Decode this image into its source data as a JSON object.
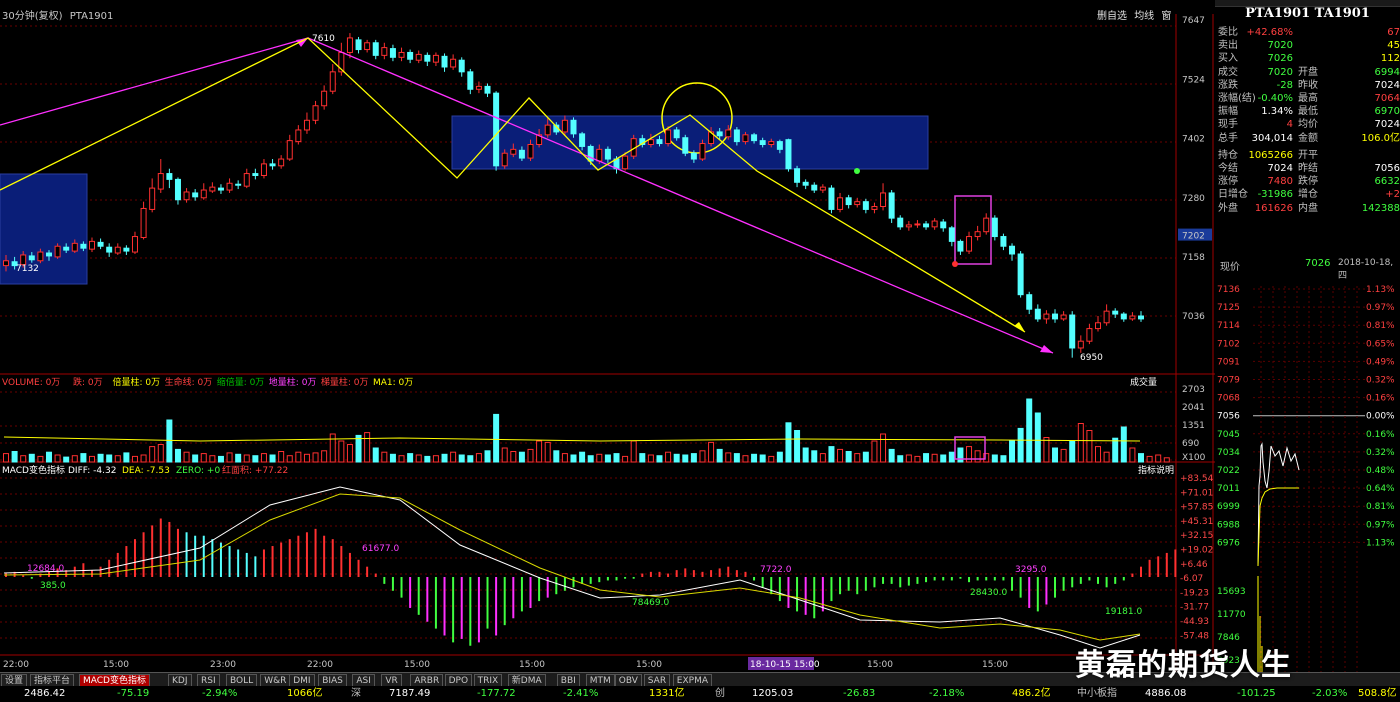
{
  "header": {
    "period_label": "30分钟(复权)",
    "symbol": "PTA1901",
    "right_tools": [
      "删自选",
      "均线",
      "窗"
    ]
  },
  "price_axis": [
    "7647",
    "7524",
    "7402",
    "7280",
    "7202",
    "7158",
    "7036"
  ],
  "price_annotations": {
    "high": "7610",
    "low_left": "7132",
    "low_right": "6950"
  },
  "volume_panel": {
    "title_items": [
      {
        "label": "VOLUME: 0万",
        "color": "#ff4040"
      },
      {
        "label": "跌: 0万",
        "color": "#ff4040"
      },
      {
        "label": "倍量柱: 0万",
        "color": "#ffff00"
      },
      {
        "label": "生命线: 0万",
        "color": "#ff4040"
      },
      {
        "label": "缩倍量: 0万",
        "color": "#00c000"
      },
      {
        "label": "地量柱: 0万",
        "color": "#ff40ff"
      },
      {
        "label": "梯量柱: 0万",
        "color": "#ff4040"
      },
      {
        "label": "MA1: 0万",
        "color": "#ffff00"
      }
    ],
    "right_label": "成交量",
    "axis": [
      "2703",
      "2041",
      "1351",
      "690",
      "X100"
    ]
  },
  "macd_panel": {
    "title": "MACD变色指标",
    "diff": "DIFF: -4.32",
    "dea": "DEA: -7.53",
    "zero": "ZERO: +0",
    "red_area": "红面积: +77.22",
    "right_label": "指标说明",
    "axis": [
      "+83.54",
      "+71.01",
      "+57.85",
      "+45.31",
      "+32.15",
      "+19.02",
      "+6.46",
      "-6.07",
      "-19.23",
      "-31.77",
      "-44.93",
      "-57.48"
    ],
    "area_labels": [
      {
        "text": "12684.0",
        "color": "#ff40ff"
      },
      {
        "text": "385.0",
        "color": "#40ff40"
      },
      {
        "text": "61677.0",
        "color": "#ff40ff"
      },
      {
        "text": "78469.0",
        "color": "#40ff40"
      },
      {
        "text": "7722.0",
        "color": "#ff40ff"
      },
      {
        "text": "28430.0",
        "color": "#40ff40"
      },
      {
        "text": "3295.0",
        "color": "#ff40ff"
      },
      {
        "text": "19181.0",
        "color": "#40ff40"
      }
    ]
  },
  "time_axis": [
    "22:00",
    "15:00",
    "23:00",
    "22:00",
    "15:00",
    "15:00",
    "15:00",
    "18-10-15 15:00",
    "15:00",
    "15:00"
  ],
  "tabs": [
    "设置",
    "指标平台",
    "MACD变色指标",
    "KDJ",
    "RSI",
    "BOLL",
    "W&R",
    "DMI",
    "BIAS",
    "ASI",
    "VR",
    "ARBR",
    "DPO",
    "TRIX",
    "新DMA",
    "BBI",
    "MTM",
    "OBV",
    "SAR",
    "EXPMA"
  ],
  "active_tab": "MACD变色指标",
  "status_bar": [
    {
      "text": "2486.42",
      "color": "#ffffff"
    },
    {
      "text": "-75.19",
      "color": "#40ff40"
    },
    {
      "text": "-2.94%",
      "color": "#40ff40"
    },
    {
      "text": "1066亿",
      "color": "#ffff00"
    },
    {
      "text": "深",
      "color": "#c0c0c0"
    },
    {
      "text": "7187.49",
      "color": "#ffffff"
    },
    {
      "text": "-177.72",
      "color": "#40ff40"
    },
    {
      "text": "-2.41%",
      "color": "#40ff40"
    },
    {
      "text": "1331亿",
      "color": "#ffff00"
    },
    {
      "text": "创",
      "color": "#c0c0c0"
    },
    {
      "text": "1205.03",
      "color": "#ffffff"
    },
    {
      "text": "-26.83",
      "color": "#40ff40"
    },
    {
      "text": "-2.18%",
      "color": "#40ff40"
    },
    {
      "text": "486.2亿",
      "color": "#ffff00"
    },
    {
      "text": "中小板指",
      "color": "#c0c0c0"
    },
    {
      "text": "4886.08",
      "color": "#ffffff"
    },
    {
      "text": "-101.25",
      "color": "#40ff40"
    },
    {
      "text": "-2.03%",
      "color": "#40ff40"
    },
    {
      "text": "508.8亿",
      "color": "#ffff00"
    }
  ],
  "quote": {
    "title": "PTA1901 TA1901",
    "rows": [
      {
        "l1": "委比",
        "v1": "+42.68%",
        "c1": "#ff4040",
        "l2": "",
        "v2": "67",
        "c2": "#ff4040"
      },
      {
        "l1": "卖出",
        "v1": "7020",
        "c1": "#40ff40",
        "l2": "",
        "v2": "45",
        "c2": "#ffff00"
      },
      {
        "l1": "买入",
        "v1": "7026",
        "c1": "#40ff40",
        "l2": "",
        "v2": "112",
        "c2": "#ffff00"
      },
      {
        "l1": "成交",
        "v1": "7020",
        "c1": "#40ff40",
        "l2": "开盘",
        "v2": "6994",
        "c2": "#40ff40"
      },
      {
        "l1": "涨跌",
        "v1": "-28",
        "c1": "#40ff40",
        "l2": "昨收",
        "v2": "7024",
        "c2": "#ffffff"
      },
      {
        "l1": "涨幅(结)",
        "v1": "-0.40%",
        "c1": "#40ff40",
        "l2": "最高",
        "v2": "7064",
        "c2": "#ff4040"
      },
      {
        "l1": "振幅",
        "v1": "1.34%",
        "c1": "#ffffff",
        "l2": "最低",
        "v2": "6970",
        "c2": "#40ff40"
      },
      {
        "l1": "现手",
        "v1": "4",
        "c1": "#ff4040",
        "l2": "均价",
        "v2": "7024",
        "c2": "#ffffff"
      },
      {
        "l1": "总手",
        "v1": "304,014",
        "c1": "#ffffff",
        "l2": "金额",
        "v2": "106.0亿",
        "c2": "#ffff00"
      },
      {
        "l1": "持仓",
        "v1": "1065266",
        "c1": "#ffff00",
        "l2": "开平",
        "v2": "",
        "c2": "#ffffff"
      },
      {
        "l1": "今结",
        "v1": "7024",
        "c1": "#ffffff",
        "l2": "昨结",
        "v2": "7056",
        "c2": "#ffffff"
      },
      {
        "l1": "涨停",
        "v1": "7480",
        "c1": "#ff4040",
        "l2": "跌停",
        "v2": "6632",
        "c2": "#40ff40"
      },
      {
        "l1": "日增仓",
        "v1": "-31986",
        "c1": "#40ff40",
        "l2": "增仓",
        "v2": "+2",
        "c2": "#ff4040"
      },
      {
        "l1": "外盘",
        "v1": "161626",
        "c1": "#ff4040",
        "l2": "内盘",
        "v2": "142388",
        "c2": "#40ff40"
      }
    ],
    "now_label": "现价",
    "now_value": "7026",
    "date": "2018-10-18,四",
    "tick_axis_left": [
      "7136",
      "7125",
      "7114",
      "7102",
      "7091",
      "7079",
      "7068",
      "7056",
      "7045",
      "7034",
      "7022",
      "7011",
      "6999",
      "6988",
      "6976"
    ],
    "tick_axis_right": [
      "1.13%",
      "0.97%",
      "0.81%",
      "0.65%",
      "0.49%",
      "0.32%",
      "0.16%",
      "0.00%",
      "0.16%",
      "0.32%",
      "0.48%",
      "0.64%",
      "0.81%",
      "0.97%",
      "1.13%"
    ],
    "vol_axis": [
      "15693",
      "11770",
      "7846",
      "3923"
    ]
  },
  "watermark": "黄磊的期货人生",
  "colors": {
    "up": "#ff3030",
    "down": "#54ffff",
    "ma": "#ffff00",
    "trend": "#ff30ff",
    "box": "#0a1e78"
  }
}
